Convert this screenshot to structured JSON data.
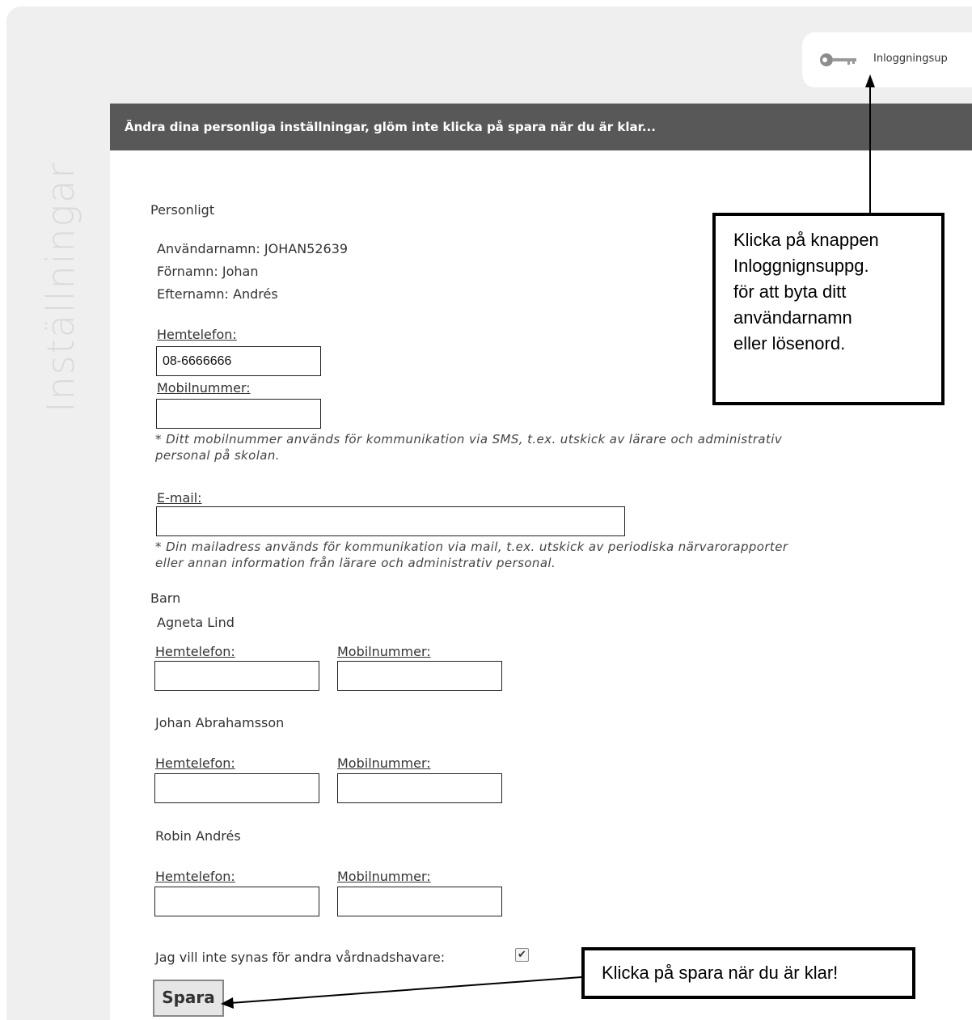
{
  "sidebar": {
    "title": "Inställningar"
  },
  "top_tab": {
    "label": "Inloggningsup",
    "icon": "key-icon"
  },
  "header": {
    "text": "Ändra dina personliga inställningar, glöm inte klicka på spara när du är klar..."
  },
  "personal": {
    "section_title": "Personligt",
    "username": "Användarnamn: JOHAN52639",
    "firstname": "Förnamn: Johan",
    "lastname": "Efternamn: Andrés",
    "home_phone_label": "Hemtelefon:",
    "home_phone_value": "08-6666666",
    "mobile_label": "Mobilnummer:",
    "mobile_value": "",
    "mobile_note_line1": "* Ditt mobilnummer används för kommunikation via SMS, t.ex. utskick av lärare och administrativ",
    "mobile_note_line2": "personal på skolan.",
    "email_label": "E-mail:",
    "email_value": "",
    "email_note_line1": "* Din mailadress används för kommunikation via mail, t.ex. utskick av periodiska närvarorapporter",
    "email_note_line2": "eller annan information från lärare och administrativ personal."
  },
  "children": {
    "section_title": "Barn",
    "list": [
      {
        "name": "Agneta Lind",
        "home_phone_label": "Hemtelefon:",
        "mobile_label": "Mobilnummer:",
        "home_phone_value": "",
        "mobile_value": ""
      },
      {
        "name": "Johan Abrahamsson",
        "home_phone_label": "Hemtelefon:",
        "mobile_label": "Mobilnummer:",
        "home_phone_value": "",
        "mobile_value": ""
      },
      {
        "name": "Robin Andrés",
        "home_phone_label": "Hemtelefon:",
        "mobile_label": "Mobilnummer:",
        "home_phone_value": "",
        "mobile_value": ""
      }
    ]
  },
  "privacy": {
    "label": "Jag vill inte synas för andra vårdnadshavare:",
    "checked": true
  },
  "save_button": {
    "label": "Spara"
  },
  "callouts": {
    "login": [
      "Klicka på knappen",
      "Inloggnignsuppg.",
      "för att byta ditt",
      "användarnamn",
      "eller lösenord."
    ],
    "save": "Klicka på spara när du är klar!"
  }
}
